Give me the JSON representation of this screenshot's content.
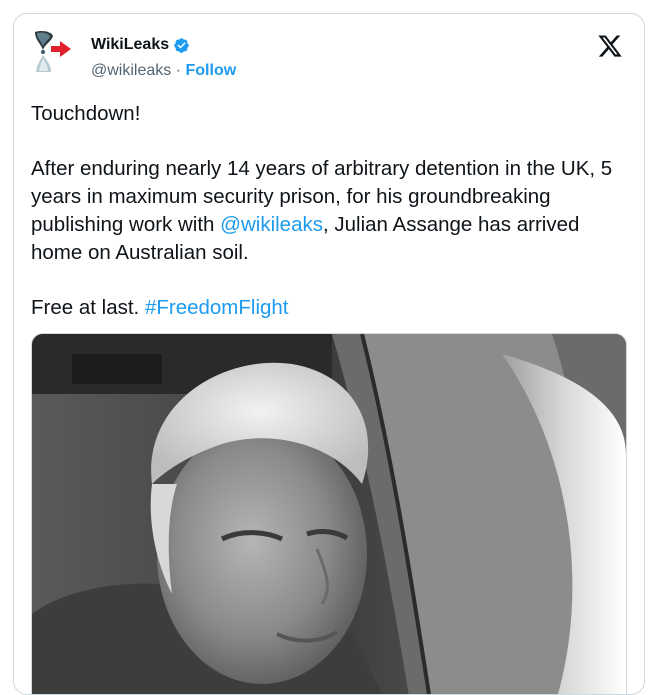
{
  "author": {
    "name": "WikiLeaks",
    "handle": "@wikileaks",
    "separator": "·",
    "follow_label": "Follow"
  },
  "tweet": {
    "line1": "Touchdown!",
    "para2_text": "After enduring nearly 14 years of arbitrary detention in the UK, 5 years in maximum security prison, for his groundbreaking publishing work with ",
    "mention": "@wikileaks",
    "para2_end": ", Julian Assange has arrived home on Australian soil.",
    "para3_text": "Free at last. ",
    "hashtag": "#FreedomFlight"
  },
  "colors": {
    "link": "#1d9bf0",
    "verified": "#1d9bf0",
    "text": "#0f1419",
    "muted": "#536471"
  },
  "icons": [
    "wikileaks-logo-icon",
    "verified-badge-icon",
    "x-logo-icon"
  ]
}
